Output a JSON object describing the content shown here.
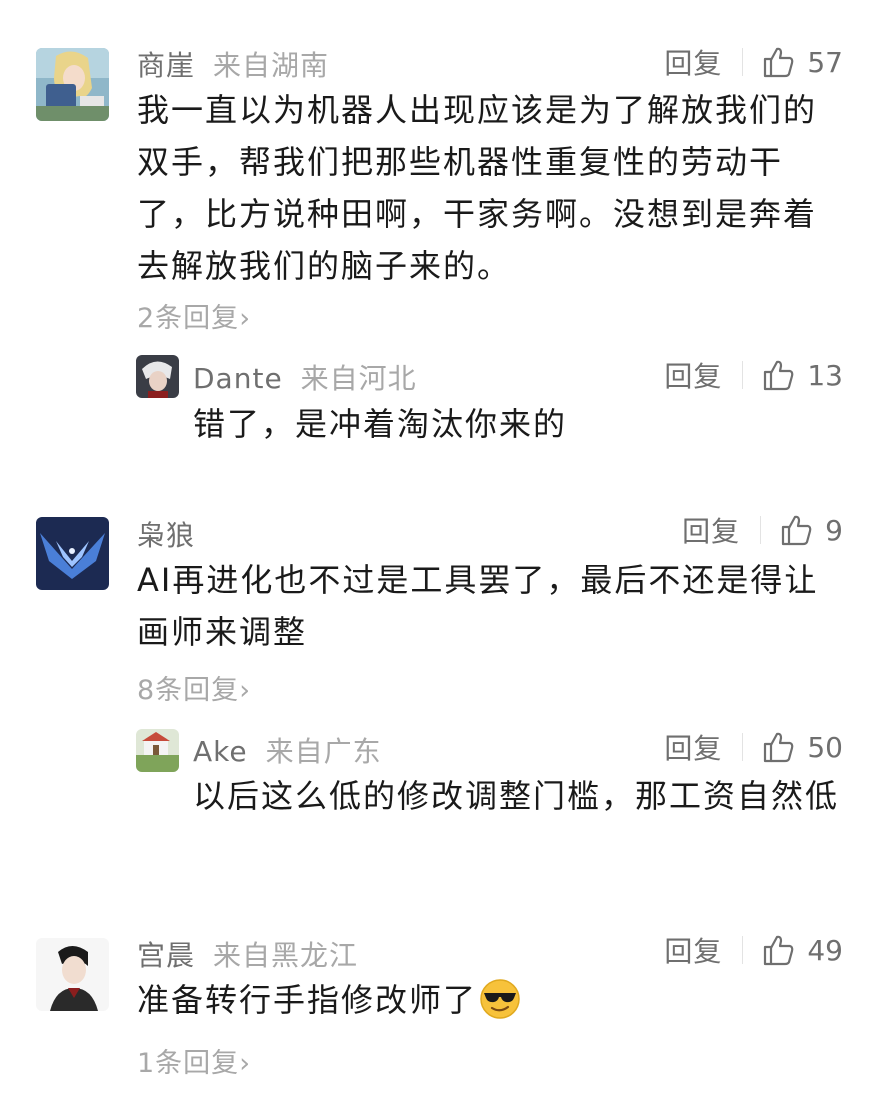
{
  "comments": [
    {
      "user": "商崖",
      "location": "来自湖南",
      "reply_label": "回复",
      "likes": "57",
      "text": "我一直以为机器人出现应该是为了解放我们的双手，帮我们把那些机器性重复性的劳动干了，比方说种田啊，干家务啊。没想到是奔着去解放我们的脑子来的。",
      "more_replies": "2条回复",
      "sub": {
        "user": "Dante",
        "location": "来自河北",
        "reply_label": "回复",
        "likes": "13",
        "text": "错了，是冲着淘汰你来的"
      }
    },
    {
      "user": "枭狼",
      "location": "",
      "reply_label": "回复",
      "likes": "9",
      "text": "AI再进化也不过是工具罢了，最后不还是得让画师来调整",
      "more_replies": "8条回复",
      "sub": {
        "user": "Ake",
        "location": "来自广东",
        "reply_label": "回复",
        "likes": "50",
        "text": "以后这么低的修改调整门槛，那工资自然低"
      }
    },
    {
      "user": "宫晨",
      "location": "来自黑龙江",
      "reply_label": "回复",
      "likes": "49",
      "text": "准备转行手指修改师了",
      "emoji": "sunglasses-emoji",
      "more_replies": "1条回复"
    }
  ],
  "icons": {
    "like": "thumbs-up-icon",
    "chevron": "chevron-right-icon"
  },
  "colors": {
    "primary_text": "#1a1a1a",
    "secondary_text": "#6f6f6f",
    "muted_text": "#a8a8a8"
  }
}
